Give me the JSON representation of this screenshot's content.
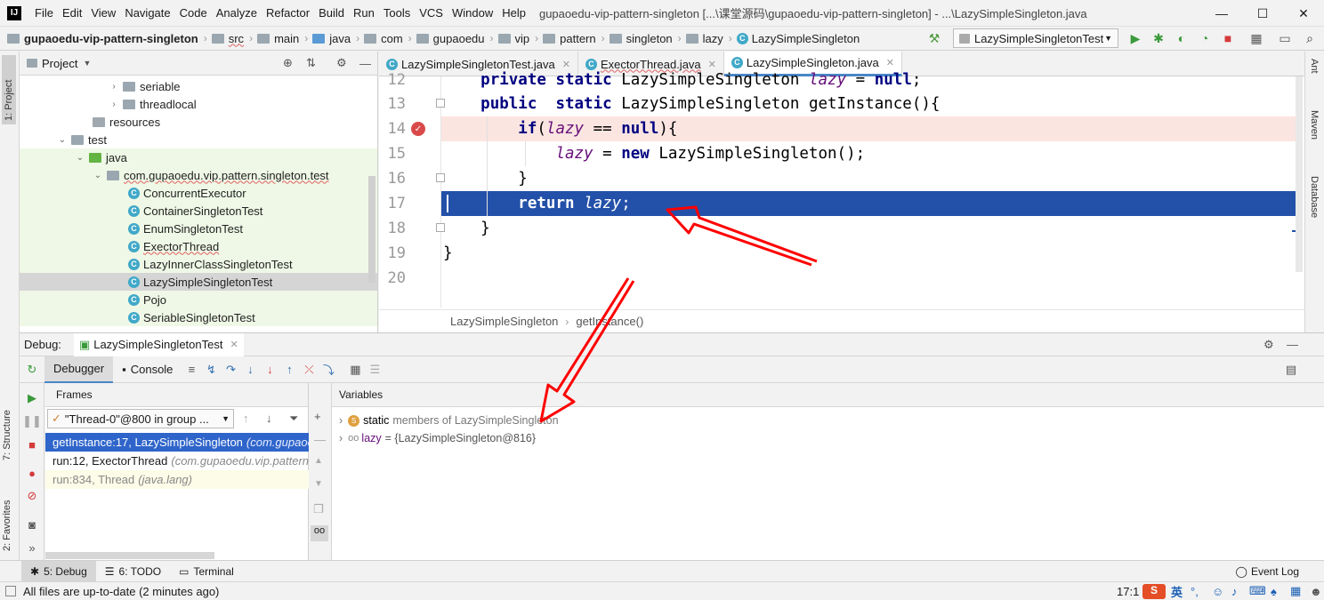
{
  "app": {
    "logo": "IJ",
    "menu": [
      "File",
      "Edit",
      "View",
      "Navigate",
      "Code",
      "Analyze",
      "Refactor",
      "Build",
      "Run",
      "Tools",
      "VCS",
      "Window",
      "Help"
    ],
    "window_title": "gupaoedu-vip-pattern-singleton [...\\课堂源码\\gupaoedu-vip-pattern-singleton] - ...\\LazySimpleSingleton.java",
    "controls": {
      "minimize": "—",
      "maximize": "☐",
      "close": "✕"
    }
  },
  "breadcrumb": {
    "items": [
      "gupaoedu-vip-pattern-singleton",
      "src",
      "main",
      "java",
      "com",
      "gupaoedu",
      "vip",
      "pattern",
      "singleton",
      "lazy",
      "LazySimpleSingleton"
    ],
    "run_config": "LazySimpleSingletonTest"
  },
  "left_stripe": {
    "project": "1: Project",
    "structure": "7: Structure",
    "favorites": "2: Favorites"
  },
  "right_stripe": {
    "ant": "Ant",
    "maven": "Maven",
    "database": "Database"
  },
  "project": {
    "title": "Project",
    "tree": [
      {
        "label": "seriable",
        "type": "folder",
        "level": 2,
        "arrow": "›"
      },
      {
        "label": "threadlocal",
        "type": "folder",
        "level": 2,
        "arrow": "›"
      },
      {
        "label": "resources",
        "type": "folder",
        "level": 1,
        "arrow": ""
      },
      {
        "label": "test",
        "type": "folder",
        "level": 0,
        "arrow": "⌄"
      },
      {
        "label": "java",
        "type": "srcfolder",
        "level": 1,
        "arrow": "⌄"
      },
      {
        "label": "com.gupaoedu.vip.pattern.singleton.test",
        "type": "package",
        "level": 2,
        "arrow": "⌄"
      },
      {
        "label": "ConcurrentExecutor",
        "type": "class",
        "level": 3
      },
      {
        "label": "ContainerSingletonTest",
        "type": "class",
        "level": 3
      },
      {
        "label": "EnumSingletonTest",
        "type": "class",
        "level": 3
      },
      {
        "label": "ExectorThread",
        "type": "class",
        "level": 3
      },
      {
        "label": "LazyInnerClassSingletonTest",
        "type": "class",
        "level": 3
      },
      {
        "label": "LazySimpleSingletonTest",
        "type": "class",
        "level": 3
      },
      {
        "label": "Pojo",
        "type": "class",
        "level": 3
      },
      {
        "label": "SeriableSingletonTest",
        "type": "class",
        "level": 3
      }
    ]
  },
  "editor": {
    "tabs": [
      {
        "label": "LazySimpleSingletonTest.java"
      },
      {
        "label": "ExectorThread.java"
      },
      {
        "label": "LazySimpleSingleton.java"
      }
    ],
    "active_tab": 2,
    "line_numbers": [
      "12",
      "13",
      "14",
      "15",
      "16",
      "17",
      "18",
      "19",
      "20"
    ],
    "tokens": {
      "private": "private",
      "public": "public",
      "static": "static",
      "type": "LazySimpleSingleton",
      "lazy": "lazy",
      "null": "null",
      "if": "if",
      "new": "new",
      "return": "return"
    },
    "breadcrumb": [
      "LazySimpleSingleton",
      "getInstance()"
    ],
    "current_line": "17",
    "breakpoint_line": "14"
  },
  "debug": {
    "label": "Debug:",
    "session": "LazySimpleSingletonTest",
    "tabs": [
      "Debugger",
      "Console"
    ],
    "frames_title": "Frames",
    "thread": "\"Thread-0\"@800 in group ...",
    "frames": [
      {
        "method": "getInstance:17, LazySimpleSingleton",
        "pkg": "(com.gupaoedu.vip.pattern.singleton.lazy)"
      },
      {
        "method": "run:12, ExectorThread",
        "pkg": "(com.gupaoedu.vip.pattern.singleton.test)"
      },
      {
        "method": "run:834, Thread",
        "pkg": "(java.lang)"
      }
    ],
    "variables_title": "Variables",
    "variables": [
      {
        "name": "static",
        "value": "members of LazySimpleSingleton"
      },
      {
        "name": "lazy",
        "value": "= {LazySimpleSingleton@816}"
      }
    ]
  },
  "bottom_tabs": [
    {
      "label": "5: Debug"
    },
    {
      "label": "6: TODO"
    },
    {
      "label": "Terminal"
    }
  ],
  "event_log": "Event Log",
  "status": {
    "message": "All files are up-to-date (2 minutes ago)",
    "position": "17:1",
    "ime": "英"
  },
  "colors": {
    "selection": "#2350a8",
    "breakpoint_line": "#fbe5e1",
    "arrow": "#ff0000",
    "keyword": "#000080",
    "field": "#660e7a"
  }
}
